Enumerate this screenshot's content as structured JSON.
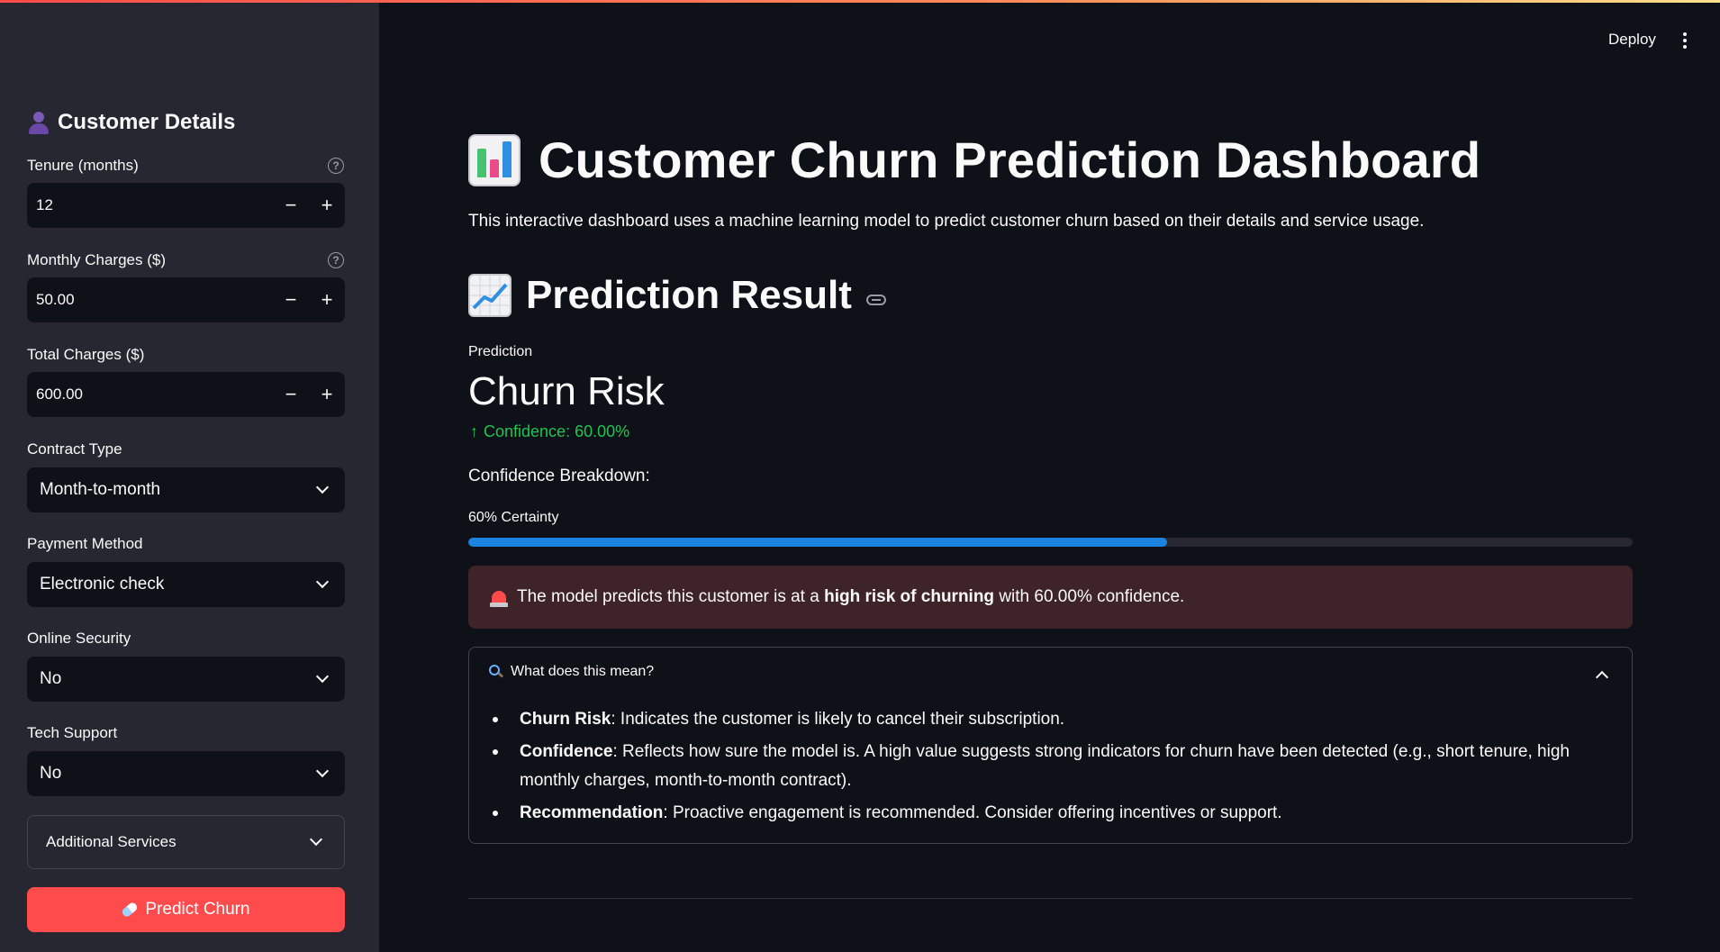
{
  "sidebar": {
    "header": "Customer Details",
    "fields": {
      "tenure": {
        "label": "Tenure (months)",
        "value": "12"
      },
      "monthly_charges": {
        "label": "Monthly Charges ($)",
        "value": "50.00"
      },
      "total_charges": {
        "label": "Total Charges ($)",
        "value": "600.00"
      },
      "contract_type": {
        "label": "Contract Type",
        "value": "Month-to-month"
      },
      "payment_method": {
        "label": "Payment Method",
        "value": "Electronic check"
      },
      "online_security": {
        "label": "Online Security",
        "value": "No"
      },
      "tech_support": {
        "label": "Tech Support",
        "value": "No"
      }
    },
    "step_minus": "−",
    "step_plus": "+",
    "help_glyph": "?",
    "additional_services": "Additional Services",
    "predict_button": "Predict Churn"
  },
  "header": {
    "deploy": "Deploy"
  },
  "main": {
    "title": "Customer Churn Prediction Dashboard",
    "intro": "This interactive dashboard uses a machine learning model to predict customer churn based on their details and service usage.",
    "subtitle": "Prediction Result",
    "metric": {
      "label": "Prediction",
      "value": "Churn Risk",
      "delta": "Confidence: 60.00%",
      "delta_arrow": "↑"
    },
    "breakdown_label": "Confidence Breakdown:",
    "progress": {
      "label": "60% Certainty",
      "fraction": 0.6
    },
    "alert": {
      "pre": "The model predicts this customer is at a",
      "bold": "high risk of churning",
      "post": "with 60.00% confidence."
    },
    "explainer": {
      "title": "What does this mean?",
      "items": [
        {
          "term": "Churn Risk",
          "text": ": Indicates the customer is likely to cancel their subscription."
        },
        {
          "term": "Confidence",
          "text": ": Reflects how sure the model is. A high value suggests strong indicators for churn have been detected (e.g., short tenure, high monthly charges, month-to-month contract)."
        },
        {
          "term": "Recommendation",
          "text": ": Proactive engagement is recommended. Consider offering incentives or support."
        }
      ]
    }
  },
  "colors": {
    "accent": "#ff4b4b",
    "progress": "#1c83e1",
    "positive": "#21c354",
    "alert_bg": "#3e2428"
  },
  "icons": [
    "person-icon",
    "help-icon",
    "chevron-down-icon",
    "rocket-icon",
    "bar-chart-icon",
    "line-chart-icon",
    "link-icon",
    "arrow-up-icon",
    "siren-icon",
    "magnifier-icon",
    "chevron-up-icon",
    "kebab-menu-icon"
  ]
}
